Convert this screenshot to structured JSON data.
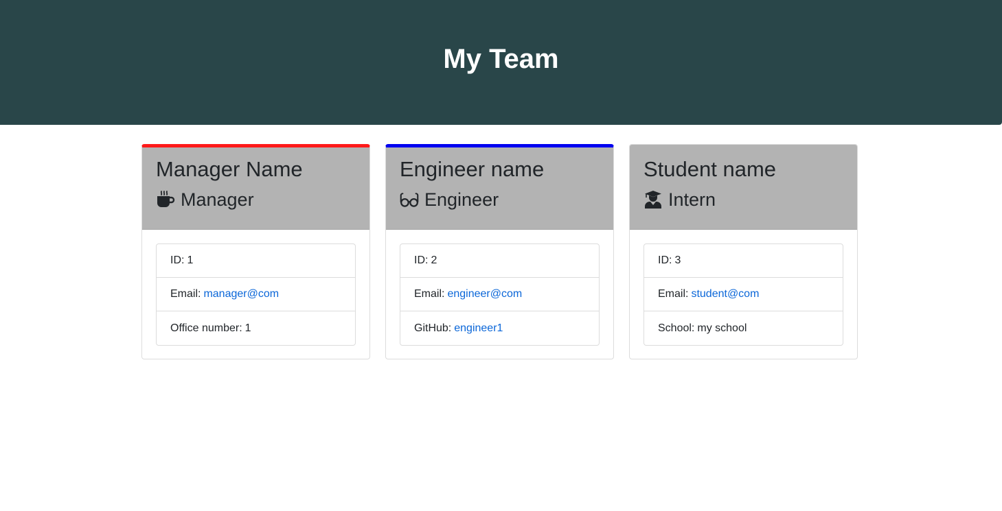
{
  "header": {
    "title": "My Team"
  },
  "cards": [
    {
      "name": "Manager Name",
      "role": "Manager",
      "role_icon": "coffee-cup-icon",
      "accent_color": "#ff1a1a",
      "id_label": "ID:",
      "id_value": "1",
      "email_label": "Email:",
      "email_value": "manager@com",
      "extra_label": "Office number:",
      "extra_value": "1"
    },
    {
      "name": "Engineer name",
      "role": "Engineer",
      "role_icon": "glasses-icon",
      "accent_color": "#0000f0",
      "id_label": "ID:",
      "id_value": "2",
      "email_label": "Email:",
      "email_value": "engineer@com",
      "extra_label": "GitHub:",
      "extra_value": "engineer1"
    },
    {
      "name": "Student name",
      "role": "Intern",
      "role_icon": "graduate-icon",
      "id_label": "ID:",
      "id_value": "3",
      "email_label": "Email:",
      "email_value": "student@com",
      "extra_label": "School:",
      "extra_value": "my school"
    }
  ]
}
